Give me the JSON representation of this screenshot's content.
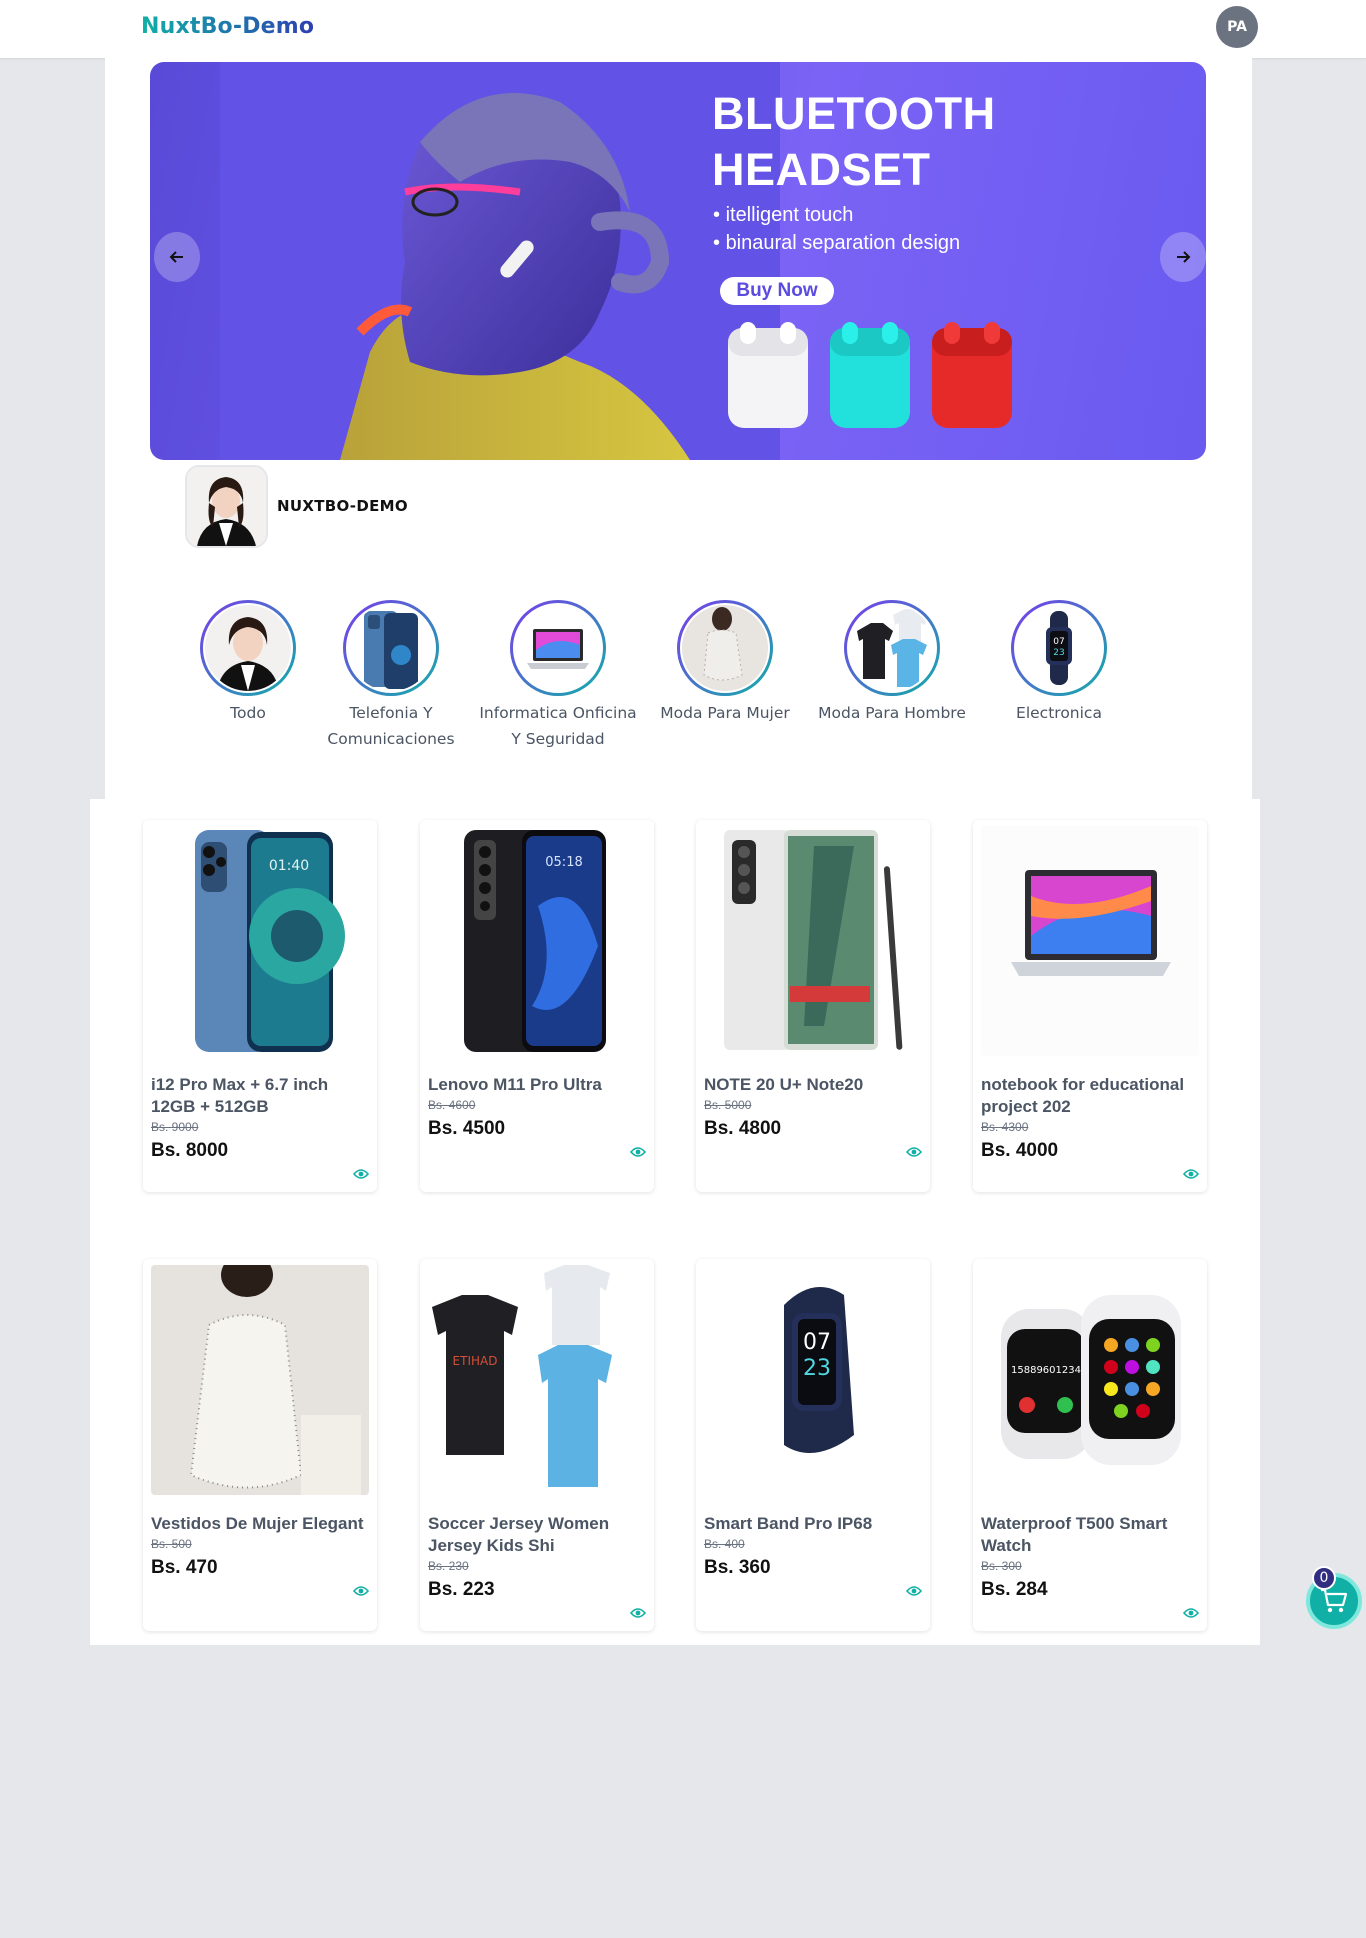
{
  "header": {
    "logo": "NuxtBo-Demo",
    "user_initials": "PA"
  },
  "banner": {
    "title_line1": "BLUETOOTH",
    "title_line2": "HEADSET",
    "bullets": [
      "itelligent touch",
      "binaural separation design"
    ],
    "cta": "Buy Now",
    "prev_icon": "arrow-left-icon",
    "next_icon": "arrow-right-icon"
  },
  "store": {
    "name": "NUXTBO-DEMO"
  },
  "categories": [
    {
      "label_line1": "Todo",
      "label_line2": ""
    },
    {
      "label_line1": "Telefonia Y",
      "label_line2": "Comunicaciones"
    },
    {
      "label_line1": "Informatica Onficina",
      "label_line2": "Y Seguridad"
    },
    {
      "label_line1": "Moda Para Mujer",
      "label_line2": ""
    },
    {
      "label_line1": "Moda Para Hombre",
      "label_line2": ""
    },
    {
      "label_line1": "Electronica",
      "label_line2": ""
    }
  ],
  "products": [
    {
      "name": "i12 Pro Max + 6.7 inch 12GB + 512GB",
      "old_price": "Bs. 9000",
      "price": "Bs. 8000"
    },
    {
      "name": "Lenovo M11 Pro Ultra",
      "old_price": "Bs. 4600",
      "price": "Bs. 4500"
    },
    {
      "name": "NOTE 20 U+ Note20",
      "old_price": "Bs. 5000",
      "price": "Bs. 4800"
    },
    {
      "name": "notebook for educational project 202",
      "old_price": "Bs. 4300",
      "price": "Bs. 4000"
    },
    {
      "name": "Vestidos De Mujer Elegant",
      "old_price": "Bs. 500",
      "price": "Bs. 470"
    },
    {
      "name": "Soccer Jersey Women Jersey Kids Shi",
      "old_price": "Bs. 230",
      "price": "Bs. 223"
    },
    {
      "name": "Smart Band Pro IP68",
      "old_price": "Bs. 400",
      "price": "Bs. 360"
    },
    {
      "name": "Waterproof T500 Smart Watch",
      "old_price": "Bs. 300",
      "price": "Bs. 284"
    }
  ],
  "cart": {
    "count": "0",
    "icon": "shopping-cart-icon"
  },
  "colors": {
    "accent": "#10b0a6",
    "banner": "#6e5cf0",
    "badge": "#312e81"
  }
}
